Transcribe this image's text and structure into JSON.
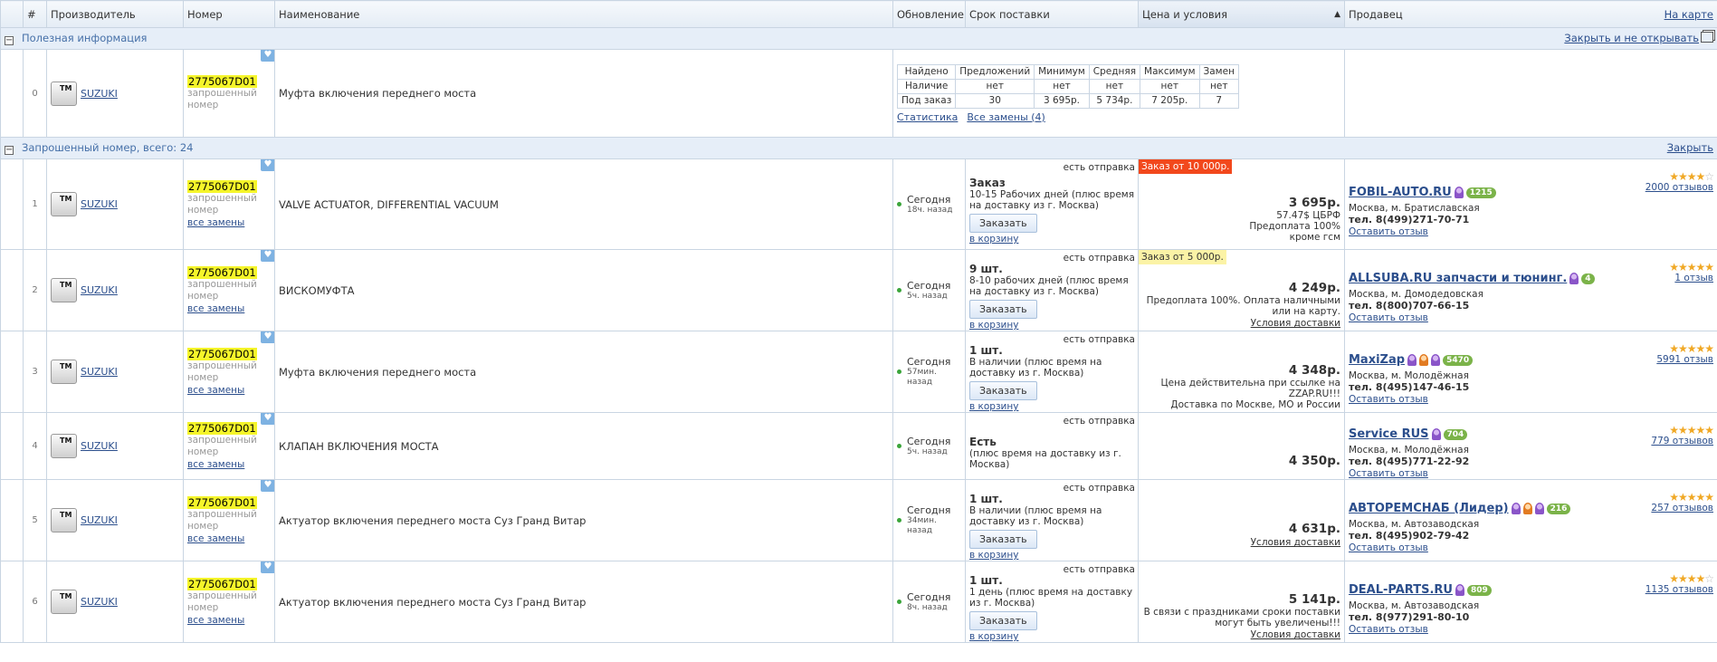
{
  "header": {
    "hash": "#",
    "manufacturer": "Производитель",
    "number": "Номер",
    "name": "Наименование",
    "update": "Обновление",
    "delivery": "Срок поставки",
    "price": "Цена и условия",
    "seller": "Продавец",
    "map_link": "На карте"
  },
  "section_info": {
    "toggle": "−",
    "title": "Полезная информация",
    "right": "Закрыть и не открывать"
  },
  "info_row": {
    "index": "0",
    "brand": "SUZUKI",
    "logo": "TM",
    "number": "2775067D01",
    "number_sub1": "запрошенный",
    "number_sub2": "номер",
    "name": "Муфта включения переднего моста",
    "stats_headers": [
      "Найдено",
      "Предложений",
      "Минимум",
      "Средняя",
      "Максимум",
      "Замен"
    ],
    "stats_rows": [
      [
        "Наличие",
        "нет",
        "нет",
        "нет",
        "нет",
        "нет"
      ],
      [
        "Под заказ",
        "30",
        "3 695р.",
        "5 734р.",
        "7 205р.",
        "7"
      ]
    ],
    "stats_link": "Статистика",
    "replacements_link": "Все замены (4)"
  },
  "section_req": {
    "toggle": "−",
    "title": "Запрошенный номер, всего: 24",
    "right": "Закрыть"
  },
  "common": {
    "brand": "SUZUKI",
    "logo": "TM",
    "number": "2775067D01",
    "number_sub1": "запрошенный",
    "number_sub2": "номер",
    "all_replacements": "все замены",
    "dispatch": "есть отправка",
    "order_button": "Заказать",
    "cart_link": "в корзину",
    "update_main": "Сегодня",
    "review_link": "Оставить отзыв",
    "fav_icon": "♥"
  },
  "rows": [
    {
      "index": "1",
      "name": "VALVE ACTUATOR, DIFFERENTIAL VACUUM",
      "update_sub1": "18ч. назад",
      "update_sub2": "",
      "qty": "Заказ",
      "terms": "10-15 Рабочих дней (плюс время на доставку из г. Москва)",
      "badge": "Заказ от 10 000р.",
      "badge_color": "#f2481c",
      "price": "3 695р.",
      "notes": [
        "57.47$ ЦБРФ",
        "Предоплата 100%",
        "кроме гсм"
      ],
      "conditions_link": "",
      "seller": "FOBIL-AUTO.RU",
      "ribbons": [
        "purple"
      ],
      "score": "1215",
      "location": "Москва, м. Братиславская",
      "phone": "тел. 8(499)271-70-71",
      "stars": 4,
      "reviews": "2000 отзывов"
    },
    {
      "index": "2",
      "name": "ВИСКОМУФТА",
      "update_sub1": "5ч. назад",
      "update_sub2": "",
      "qty": "9 шт.",
      "terms": "8-10 рабочих дней (плюс время на доставку из г. Москва)",
      "badge": "Заказ от 5 000р.",
      "badge_color": "#fbf3a6",
      "price": "4 249р.",
      "notes": [
        "Предоплата 100%. Оплата наличными",
        "или на карту."
      ],
      "conditions_link": "Условия доставки",
      "seller": "ALLSUBA.RU запчасти и тюнинг.",
      "ribbons": [
        "purple"
      ],
      "score": "4",
      "location": "Москва, м. Домодедовская",
      "phone": "тел. 8(800)707-66-15",
      "stars": 5,
      "reviews": "1 отзыв"
    },
    {
      "index": "3",
      "name": "Муфта включения переднего моста",
      "update_sub1": "57мин.",
      "update_sub2": "назад",
      "qty": "1 шт.",
      "terms": "В наличии (плюс время на доставку из г. Москва)",
      "badge": "",
      "badge_color": "",
      "price": "4 348р.",
      "notes": [
        "Цена действительна при ссылке на",
        "ZZAP.RU!!!",
        "Доставка по Москве, МО и России"
      ],
      "conditions_link": "",
      "seller": "MaxiZap",
      "ribbons": [
        "purple",
        "orange",
        "purple"
      ],
      "score": "5470",
      "location": "Москва, м. Молодёжная",
      "phone": "тел. 8(495)147-46-15",
      "stars": 5,
      "reviews": "5991 отзыв"
    },
    {
      "index": "4",
      "name": "КЛАПАН ВКЛЮЧЕНИЯ МОСТА",
      "update_sub1": "5ч. назад",
      "update_sub2": "",
      "qty": "Есть",
      "terms": "(плюс время на доставку из г. Москва)",
      "badge": "",
      "badge_color": "",
      "price": "4 350р.",
      "notes": [],
      "conditions_link": "",
      "seller": "Service RUS",
      "ribbons": [
        "purple"
      ],
      "score": "704",
      "location": "Москва, м. Молодёжная",
      "phone": "тел. 8(495)771-22-92",
      "stars": 5,
      "reviews": "779 отзывов"
    },
    {
      "index": "5",
      "name": "Актуатор включения переднего моста Суз Гранд Витар",
      "update_sub1": "34мин.",
      "update_sub2": "назад",
      "qty": "1 шт.",
      "terms": "В наличии (плюс время на доставку из г. Москва)",
      "badge": "",
      "badge_color": "",
      "price": "4 631р.",
      "notes": [],
      "conditions_link": "Условия доставки",
      "seller": "АВТОРЕМСНАБ (Лидер)",
      "ribbons": [
        "purple",
        "orange",
        "purple"
      ],
      "score": "216",
      "location": "Москва, м. Автозаводская",
      "phone": "тел. 8(495)902-79-42",
      "stars": 5,
      "reviews": "257 отзывов"
    },
    {
      "index": "6",
      "name": "Актуатор включения переднего моста Суз Гранд Витар",
      "update_sub1": "8ч. назад",
      "update_sub2": "",
      "qty": "1 шт.",
      "terms": "1 день (плюс время на доставку из г. Москва)",
      "badge": "",
      "badge_color": "",
      "price": "5 141р.",
      "notes": [
        "В связи с праздниками сроки поставки",
        "могут быть увеличены!!!"
      ],
      "conditions_link": "Условия доставки",
      "seller": "DEAL-PARTS.RU",
      "ribbons": [
        "purple"
      ],
      "score": "809",
      "location": "Москва, м. Автозаводская",
      "phone": "тел. 8(977)291-80-10",
      "stars": 4,
      "reviews": "1135 отзывов"
    }
  ]
}
